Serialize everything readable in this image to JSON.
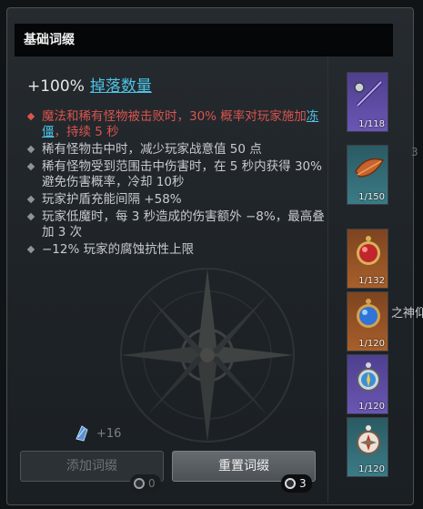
{
  "header": {
    "title": "基础词缀"
  },
  "headline": {
    "value": "+100%",
    "link_label": "掉落数量"
  },
  "affixes": [
    {
      "pre": "魔法和稀有怪物被击败时，30% 概率对玩家施加",
      "link": "冻僵",
      "post": "，持续 5 秒",
      "tone": "red"
    },
    {
      "pre": "稀有怪物击中时，减少玩家战意值 50 点",
      "link": "",
      "post": "",
      "tone": "normal"
    },
    {
      "pre": "稀有怪物受到范围击中伤害时，在 5 秒内获得 30% 避免伤害概率，冷却 10秒",
      "link": "",
      "post": "",
      "tone": "normal"
    },
    {
      "pre": "玩家护盾充能间隔 +58%",
      "link": "",
      "post": "",
      "tone": "normal"
    },
    {
      "pre": "玩家低魔时，每 3 秒造成的伤害额外 −8%，最高叠加 3 次",
      "link": "",
      "post": "",
      "tone": "normal"
    },
    {
      "pre": "−12% 玩家的腐蚀抗性上限",
      "link": "",
      "post": "",
      "tone": "normal"
    }
  ],
  "stones": {
    "count": "+16",
    "icon": "blue-crystal-icon"
  },
  "buttons": {
    "add_label": "添加词缀",
    "add_cost": "0",
    "reset_label": "重置词缀",
    "reset_cost": "3"
  },
  "items": [
    {
      "name": "purple-wand-icon",
      "qty": "1/118",
      "bg": "purple"
    },
    {
      "name": "orange-feather-icon",
      "qty": "1/150",
      "bg": "teal"
    },
    {
      "name": "red-gem-icon",
      "qty": "1/132",
      "bg": "orange"
    },
    {
      "name": "blue-gem-icon",
      "qty": "1/120",
      "bg": "orange"
    },
    {
      "name": "compass-charm-icon",
      "qty": "1/120",
      "bg": "purple"
    },
    {
      "name": "pink-compass-icon",
      "qty": "1/120",
      "bg": "teal"
    }
  ],
  "side": {
    "text": "之神仰",
    "mark": "3"
  }
}
